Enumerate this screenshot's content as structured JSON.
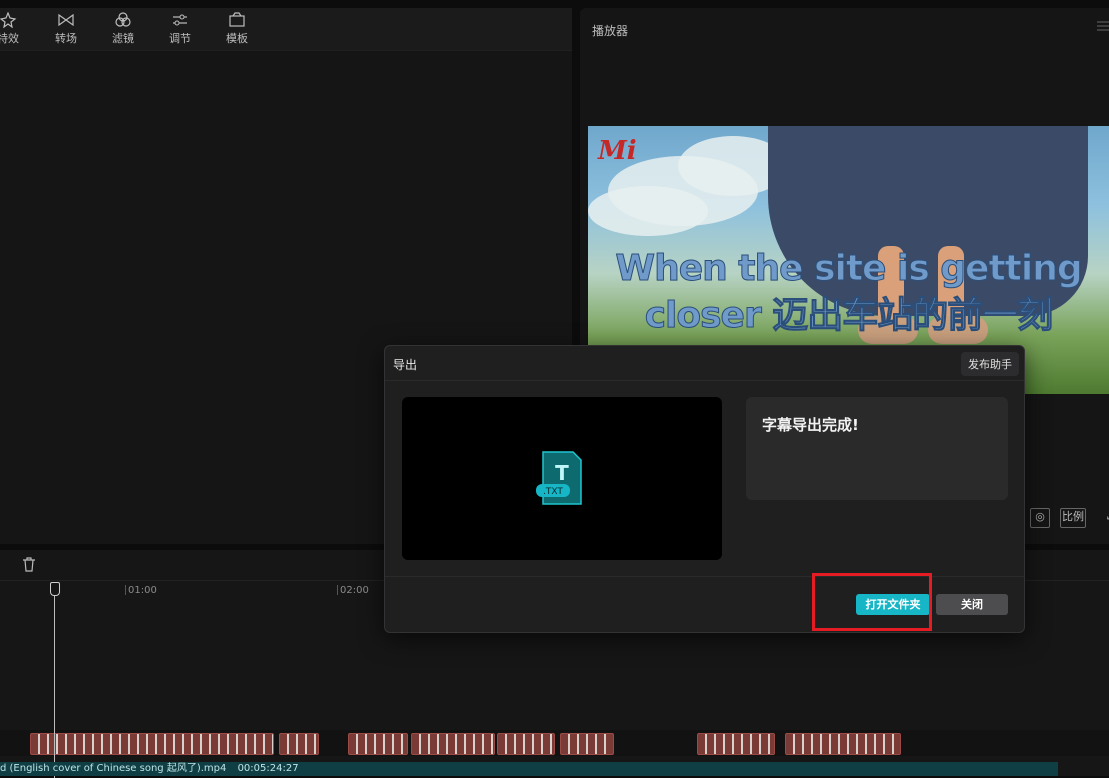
{
  "toolbar": {
    "items": [
      {
        "label": "特效",
        "icon": "sparkle-icon"
      },
      {
        "label": "转场",
        "icon": "transition-icon"
      },
      {
        "label": "滤镜",
        "icon": "filter-icon"
      },
      {
        "label": "调节",
        "icon": "sliders-icon"
      },
      {
        "label": "模板",
        "icon": "template-icon"
      }
    ]
  },
  "player": {
    "title": "播放器",
    "logo": "Mi",
    "subtitle_line1": "When the site is getting",
    "subtitle_line2": "closer 迈出车站的前一刻",
    "ratio_label": "比例"
  },
  "timeline": {
    "timecodes": [
      "01:00",
      "02:00"
    ],
    "video_track_name": "d (English cover of Chinese song 起风了).mp4",
    "video_track_duration": "00:05:24:27"
  },
  "dialog": {
    "title": "导出",
    "publish_label": "发布助手",
    "file_badge": ".TXT",
    "file_glyph": "T",
    "status": "字幕导出完成!",
    "open_folder_label": "打开文件夹",
    "close_label": "关闭"
  },
  "colors": {
    "accent": "#16b6c6",
    "highlight": "#e51c23",
    "clip": "#7a3a36"
  }
}
